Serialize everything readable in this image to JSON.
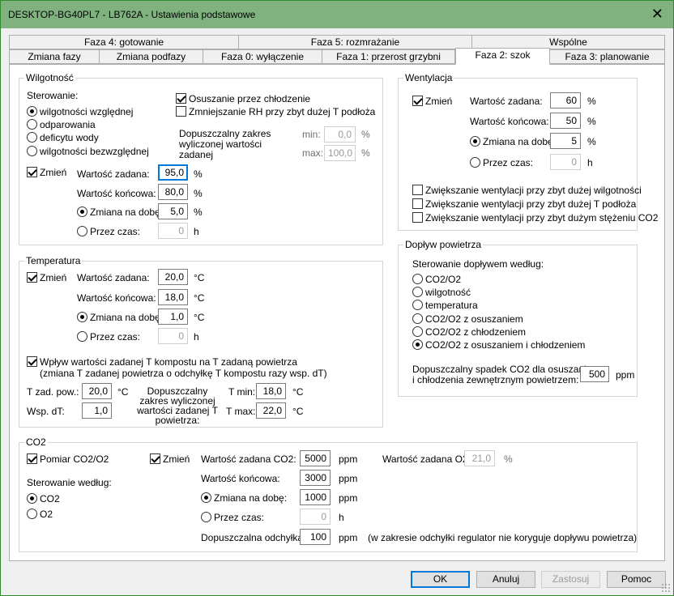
{
  "window": {
    "title": "DESKTOP-BG40PL7 - LB762A - Ustawienia podstawowe",
    "close": "✕"
  },
  "tabs": {
    "row1": [
      "Faza 4: gotowanie",
      "Faza 5: rozmrażanie",
      "Wspólne"
    ],
    "row2": [
      "Zmiana fazy",
      "Zmiana podfazy",
      "Faza 0: wyłączenie",
      "Faza 1: przerost grzybni",
      "Faza 2: szok",
      "Faza 3: planowanie"
    ]
  },
  "wilgotnosc": {
    "title": "Wilgotność",
    "sterowanie_label": "Sterowanie:",
    "options": [
      "wilgotności względnej",
      "odparowania",
      "deficytu wody",
      "wilgotności bezwzględnej"
    ],
    "osuszanie": "Osuszanie przez chłodzenie",
    "zmniejszanie": "Zmniejszanie RH przy zbyt dużej T podłoża",
    "dopuszczalny": "Dopuszczalny zakres wyliczonej wartości zadanej",
    "min_label": "min:",
    "min_value": "0,0",
    "max_label": "max:",
    "max_value": "100,0",
    "pct": "%",
    "zmien": "Zmień",
    "zadana_label": "Wartość zadana:",
    "zadana_value": "95,0",
    "koncowa_label": "Wartość końcowa:",
    "koncowa_value": "80,0",
    "zmiana_label": "Zmiana na dobę:",
    "zmiana_value": "5,0",
    "przez_label": "Przez czas:",
    "przez_value": "0",
    "h": "h"
  },
  "temperatura": {
    "title": "Temperatura",
    "zmien": "Zmień",
    "zadana_label": "Wartość zadana:",
    "zadana_value": "20,0",
    "koncowa_label": "Wartość końcowa:",
    "koncowa_value": "18,0",
    "zmiana_label": "Zmiana na dobę:",
    "zmiana_value": "1,0",
    "przez_label": "Przez czas:",
    "przez_value": "0",
    "unit_c": "°C",
    "h": "h",
    "wplyw_line1": "Wpływ wartości zadanej T kompostu na T zadaną powietrza",
    "wplyw_line2": "(zmiana T zadanej powietrza o odchyłkę T kompostu razy wsp. dT)",
    "tzad_label": "T zad. pow.:",
    "tzad_value": "20,0",
    "wsp_label": "Wsp. dT:",
    "wsp_value": "1,0",
    "dopuszczalny": "Dopuszczalny zakres wyliczonej wartości zadanej T powietrza:",
    "tmin_label": "T min:",
    "tmin_value": "18,0",
    "tmax_label": "T max:",
    "tmax_value": "22,0"
  },
  "wentylacja": {
    "title": "Wentylacja",
    "zmien": "Zmień",
    "zadana_label": "Wartość zadana:",
    "zadana_value": "60",
    "koncowa_label": "Wartość końcowa:",
    "koncowa_value": "50",
    "zmiana_label": "Zmiana na dobę:",
    "zmiana_value": "5",
    "przez_label": "Przez czas:",
    "przez_value": "0",
    "pct": "%",
    "h": "h",
    "opt1": "Zwiększanie wentylacji przy zbyt dużej wilgotności",
    "opt2": "Zwiększanie wentylacji przy zbyt dużej T podłoża",
    "opt3": "Zwiększanie wentylacji przy zbyt dużym stężeniu CO2"
  },
  "doplyw": {
    "title": "Dopływ powietrza",
    "sterowanie": "Sterowanie dopływem według:",
    "options": [
      "CO2/O2",
      "wilgotność",
      "temperatura",
      "CO2/O2 z osuszaniem",
      "CO2/O2 z chłodzeniem",
      "CO2/O2 z osuszaniem i chłodzeniem"
    ],
    "spadek_line1": "Dopuszczalny spadek CO2 dla osuszania",
    "spadek_line2": "i chłodzenia zewnętrznym powietrzem:",
    "spadek_value": "500",
    "ppm": "ppm"
  },
  "co2": {
    "title": "CO2",
    "pomiar": "Pomiar CO2/O2",
    "zmien": "Zmień",
    "sterowanie": "Sterowanie według:",
    "opt_co2": "CO2",
    "opt_o2": "O2",
    "zadana_label": "Wartość zadana CO2:",
    "zadana_value": "5000",
    "koncowa_label": "Wartość końcowa:",
    "koncowa_value": "3000",
    "zmiana_label": "Zmiana na dobę:",
    "zmiana_value": "1000",
    "przez_label": "Przez czas:",
    "przez_value": "0",
    "odchylka_label": "Dopuszczalna odchyłka:",
    "odchylka_value": "100",
    "odchylka_note": "(w zakresie odchyłki regulator nie koryguje dopływu powietrza)",
    "o2_label": "Wartość zadana O2:",
    "o2_value": "21,0",
    "ppm": "ppm",
    "pct": "%",
    "h": "h"
  },
  "buttons": {
    "ok": "OK",
    "anuluj": "Anuluj",
    "zastosuj": "Zastosuj",
    "pomoc": "Pomoc"
  }
}
